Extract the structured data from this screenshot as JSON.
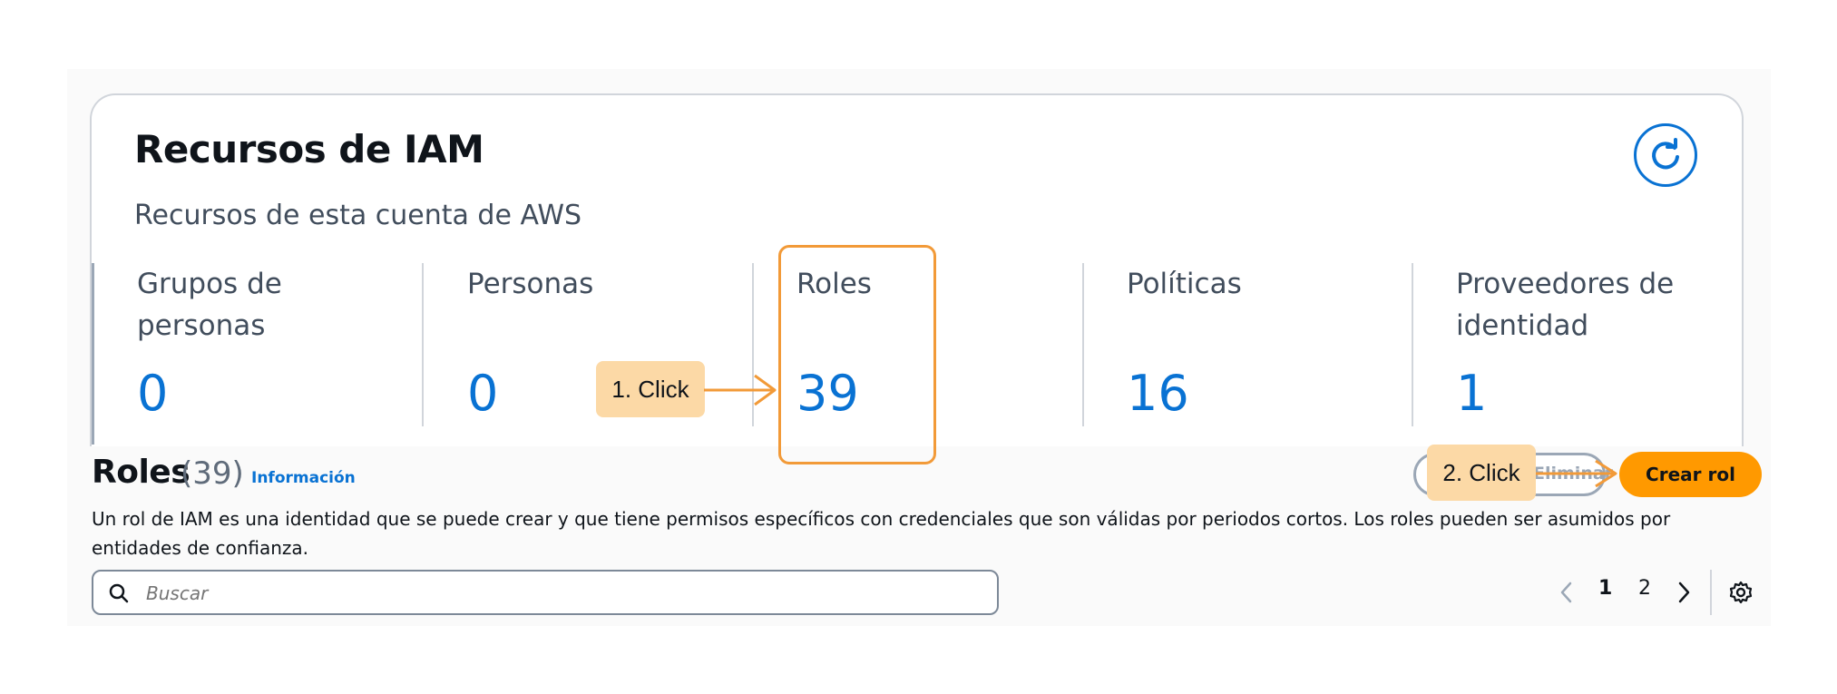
{
  "resources_card": {
    "title": "Recursos de IAM",
    "subtitle": "Recursos de esta cuenta de AWS",
    "stats": [
      {
        "label": "Grupos de personas",
        "value": "0"
      },
      {
        "label": "Personas",
        "value": "0"
      },
      {
        "label": "Roles",
        "value": "39"
      },
      {
        "label": "Políticas",
        "value": "16"
      },
      {
        "label": "Proveedores de identidad",
        "value": "1"
      }
    ]
  },
  "roles_section": {
    "title": "Roles",
    "count": "(39)",
    "info_link": "Información",
    "description": "Un rol de IAM es una identidad que se puede crear y que tiene permisos específicos con credenciales que son válidas por periodos cortos. Los roles pueden ser asumidos por entidades de confianza.",
    "search_placeholder": "Buscar",
    "delete_button": "Eliminar",
    "create_button": "Crear rol",
    "pagination": {
      "pages": [
        "1",
        "2"
      ],
      "current": "1"
    }
  },
  "annotations": {
    "step1": "1. Click",
    "step2": "2. Click",
    "accent_color": "#f29a38",
    "callout_color": "#fcd9a6"
  },
  "colors": {
    "link": "#0972d3",
    "primary_button": "#ff9900"
  }
}
